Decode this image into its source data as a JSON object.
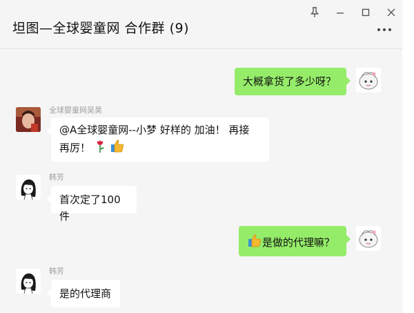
{
  "window": {
    "title": "坦图—全球婴童网 合作群 (9)"
  },
  "messages": [
    {
      "side": "out",
      "text": "大概拿货了多少呀？"
    },
    {
      "side": "in",
      "sender": "全球婴童网吴昊",
      "text_line1": "@A全球婴童网--小梦 好样的  加油！  再接",
      "text_line2": "再厉！"
    },
    {
      "side": "in",
      "sender": "韩芳",
      "text": "首次定了100件"
    },
    {
      "side": "out",
      "text": "是做的代理嘛？"
    },
    {
      "side": "in",
      "sender": "韩芳",
      "text": "是的代理商"
    }
  ],
  "icons": {
    "pin": "pin-icon",
    "minimize": "minimize-icon",
    "maximize": "maximize-icon",
    "close": "close-icon",
    "more": "more-icon",
    "rose": "rose-emoji",
    "thumbs_up": "thumbs-up-emoji"
  },
  "colors": {
    "outgoing_bubble": "#95ec69",
    "incoming_bubble": "#ffffff",
    "chat_background": "#f5f5f5"
  }
}
